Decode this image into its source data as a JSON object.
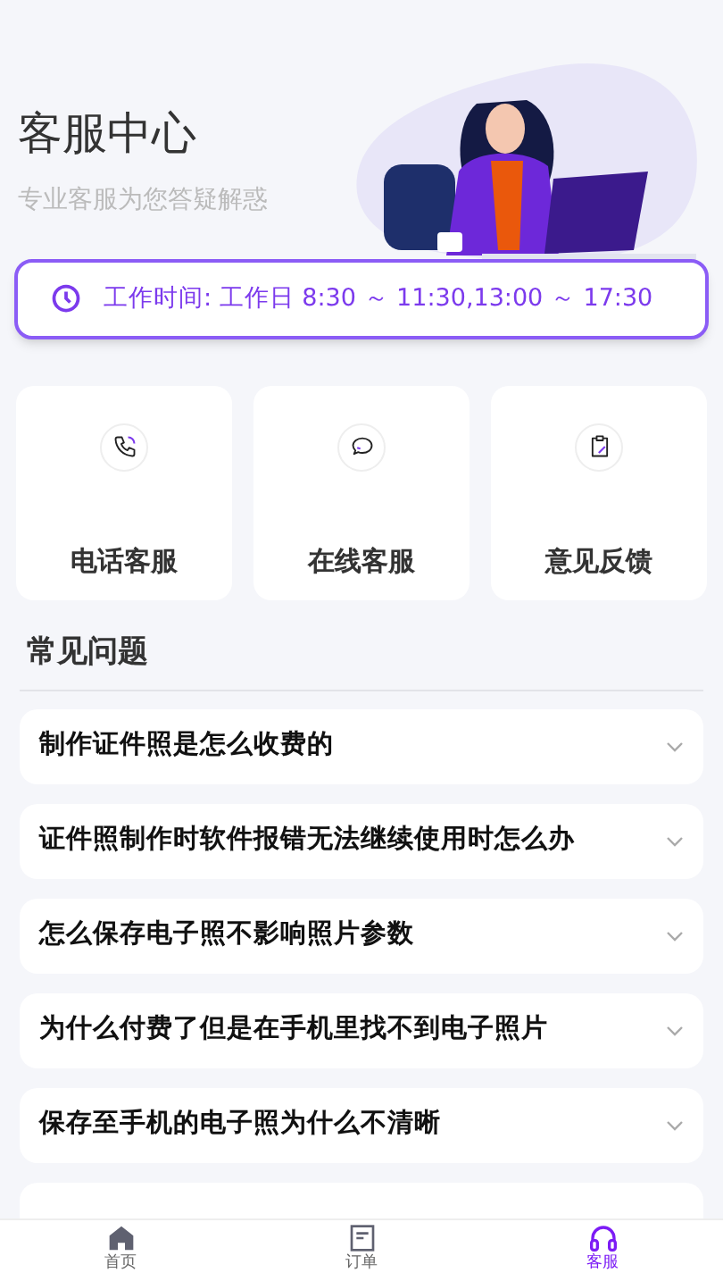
{
  "header": {
    "title": "客服中心",
    "subtitle": "专业客服为您答疑解惑"
  },
  "hours": {
    "label": "工作时间:",
    "value": "工作日 8:30 ～ 11:30,13:00 ～ 17:30"
  },
  "services": [
    {
      "kind": "phone",
      "label": "电话客服"
    },
    {
      "kind": "chat",
      "label": "在线客服"
    },
    {
      "kind": "feedback",
      "label": "意见反馈"
    }
  ],
  "faq": {
    "title": "常见问题",
    "items": [
      {
        "question": "制作证件照是怎么收费的",
        "expanded": false
      },
      {
        "question": "证件照制作时软件报错无法继续使用时怎么办",
        "expanded": false
      },
      {
        "question": "怎么保存电子照不影响照片参数",
        "expanded": false
      },
      {
        "question": "为什么付费了但是在手机里找不到电子照片",
        "expanded": false
      },
      {
        "question": "保存至手机的电子照为什么不清晰",
        "expanded": false
      }
    ]
  },
  "nav": [
    {
      "kind": "home",
      "label": "首页",
      "selected": false
    },
    {
      "kind": "orders",
      "label": "订单",
      "selected": false
    },
    {
      "kind": "support",
      "label": "客服",
      "selected": true
    }
  ]
}
